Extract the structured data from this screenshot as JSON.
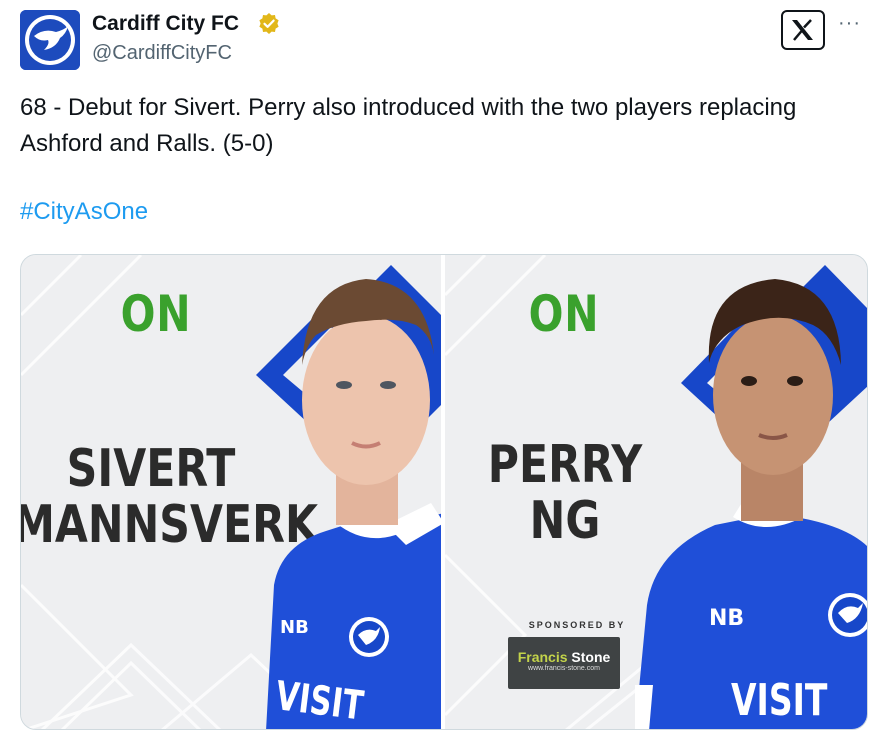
{
  "tweet": {
    "author_name": "Cardiff City FC",
    "handle": "@CardiffCityFC",
    "text": "68 - Debut for Sivert. Perry also introduced with the two players replacing Ashford and Ralls. (5-0)",
    "hashtag": "#CityAsOne",
    "icons": [
      "bluebird-crest-icon",
      "verified-badge-icon",
      "x-logo-icon",
      "more-options-icon"
    ]
  },
  "graphic": {
    "left": {
      "status": "ON",
      "name_line1": "SIVERT",
      "name_line2": "MANNSVERK",
      "shirt_text": "VISIT"
    },
    "right": {
      "status": "ON",
      "name_line1": "PERRY",
      "name_line2": "NG",
      "shirt_text": "VISIT",
      "sponsored_by": "SPONSORED BY",
      "sponsor_name_part1": "Francis",
      "sponsor_name_part2": " Stone",
      "sponsor_url": "www.francis-stone.com"
    }
  },
  "colors": {
    "link": "#1d9bf0",
    "club_blue": "#1747c9",
    "on_green": "#3aa12d"
  }
}
